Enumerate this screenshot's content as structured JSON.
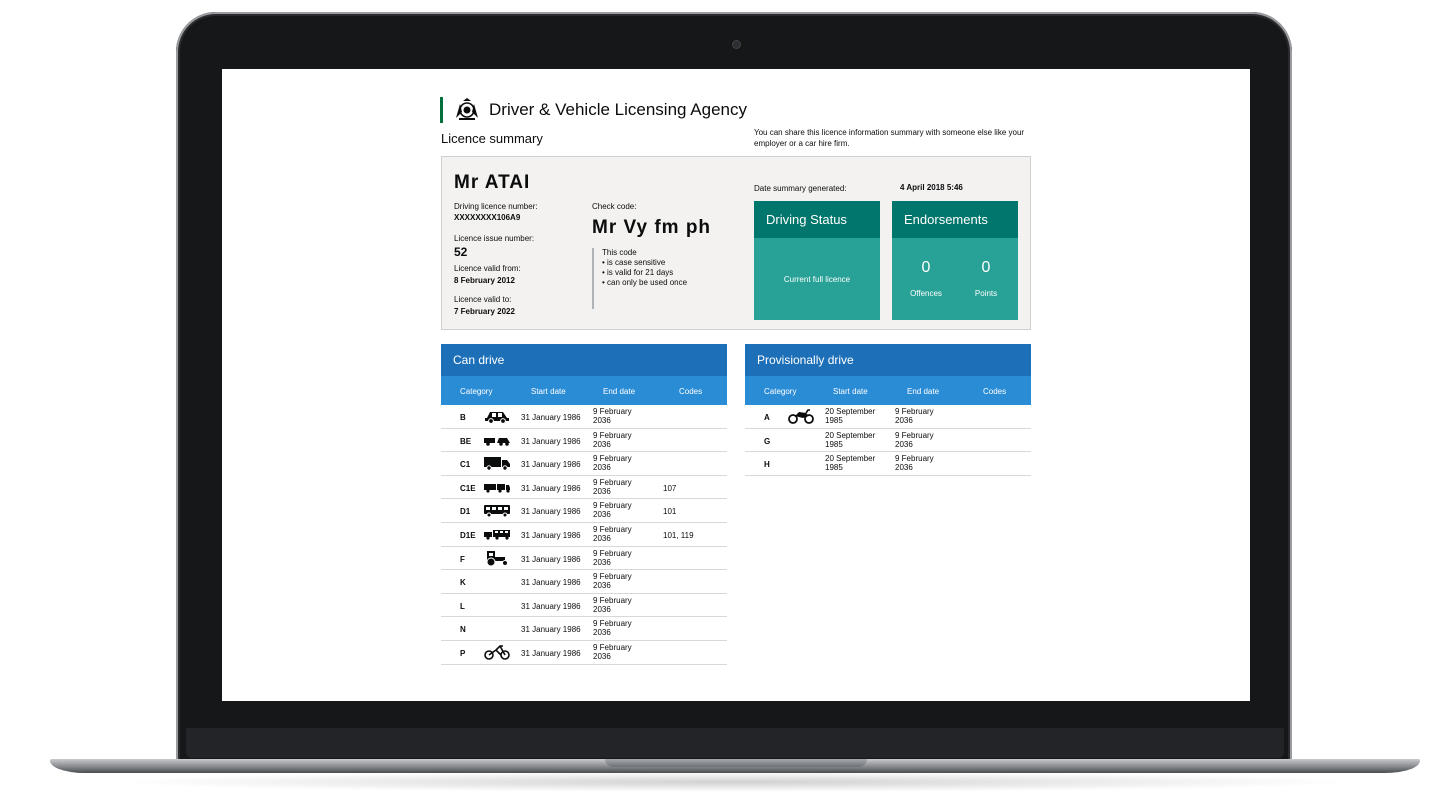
{
  "brand": {
    "name": "Driver & Vehicle Licensing Agency"
  },
  "page": {
    "title": "Licence summary",
    "share_text": "You can share this licence information summary with someone else like your employer or a car hire firm."
  },
  "summary": {
    "name": "Mr ATAI",
    "licence_number_label": "Driving licence number:",
    "licence_number": "XXXXXXXX106A9",
    "issue_number_label": "Licence issue number:",
    "issue_number": "52",
    "valid_from_label": "Licence valid from:",
    "valid_from": "8 February 2012",
    "valid_to_label": "Licence valid to:",
    "valid_to": "7 February 2022",
    "check_code_label": "Check code:",
    "check_code": "Mr Vy fm ph",
    "code_note": [
      "This code",
      "• is case sensitive",
      "• is valid for 21 days",
      "• can only be used once"
    ],
    "generated_label": "Date summary generated:",
    "generated_value": "4 April 2018  5:46",
    "driving_status": {
      "title": "Driving Status",
      "value": "Current full licence"
    },
    "endorsements": {
      "title": "Endorsements",
      "offences": "0",
      "offences_label": "Offences",
      "points": "0",
      "points_label": "Points"
    }
  },
  "can_drive": {
    "title": "Can drive",
    "columns": [
      "Category",
      "Start date",
      "End date",
      "Codes"
    ],
    "rows": [
      {
        "cat": "B",
        "icon": "car-icon",
        "start": "31 January 1986",
        "end1": "9 February",
        "end2": "2036",
        "codes": ""
      },
      {
        "cat": "BE",
        "icon": "car-trailer-icon",
        "start": "31 January 1986",
        "end1": "9 February",
        "end2": "2036",
        "codes": ""
      },
      {
        "cat": "C1",
        "icon": "lorry-icon",
        "start": "31 January 1986",
        "end1": "9 February",
        "end2": "2036",
        "codes": ""
      },
      {
        "cat": "C1E",
        "icon": "lorry-trailer-icon",
        "start": "31 January 1986",
        "end1": "9 February",
        "end2": "2036",
        "codes": "107"
      },
      {
        "cat": "D1",
        "icon": "minibus-icon",
        "start": "31 January 1986",
        "end1": "9 February",
        "end2": "2036",
        "codes": "101"
      },
      {
        "cat": "D1E",
        "icon": "minibus-trailer-icon",
        "start": "31 January 1986",
        "end1": "9 February",
        "end2": "2036",
        "codes": "101, 119"
      },
      {
        "cat": "F",
        "icon": "tractor-icon",
        "start": "31 January 1986",
        "end1": "9 February",
        "end2": "2036",
        "codes": ""
      },
      {
        "cat": "K",
        "icon": "",
        "start": "31 January 1986",
        "end1": "9 February",
        "end2": "2036",
        "codes": ""
      },
      {
        "cat": "L",
        "icon": "",
        "start": "31 January 1986",
        "end1": "9 February",
        "end2": "2036",
        "codes": ""
      },
      {
        "cat": "N",
        "icon": "",
        "start": "31 January 1986",
        "end1": "9 February",
        "end2": "2036",
        "codes": ""
      },
      {
        "cat": "P",
        "icon": "moped-icon",
        "start": "31 January 1986",
        "end1": "9 February",
        "end2": "2036",
        "codes": ""
      }
    ]
  },
  "provisional": {
    "title": "Provisionally drive",
    "columns": [
      "Category",
      "Start date",
      "End date",
      "Codes"
    ],
    "rows": [
      {
        "cat": "A",
        "icon": "motorcycle-icon",
        "start1": "20 September",
        "start2": "1985",
        "end1": "9 February",
        "end2": "2036",
        "codes": ""
      },
      {
        "cat": "G",
        "icon": "",
        "start1": "20 September",
        "start2": "1985",
        "end1": "9 February",
        "end2": "2036",
        "codes": ""
      },
      {
        "cat": "H",
        "icon": "",
        "start1": "20 September",
        "start2": "1985",
        "end1": "9 February",
        "end2": "2036",
        "codes": ""
      }
    ]
  }
}
